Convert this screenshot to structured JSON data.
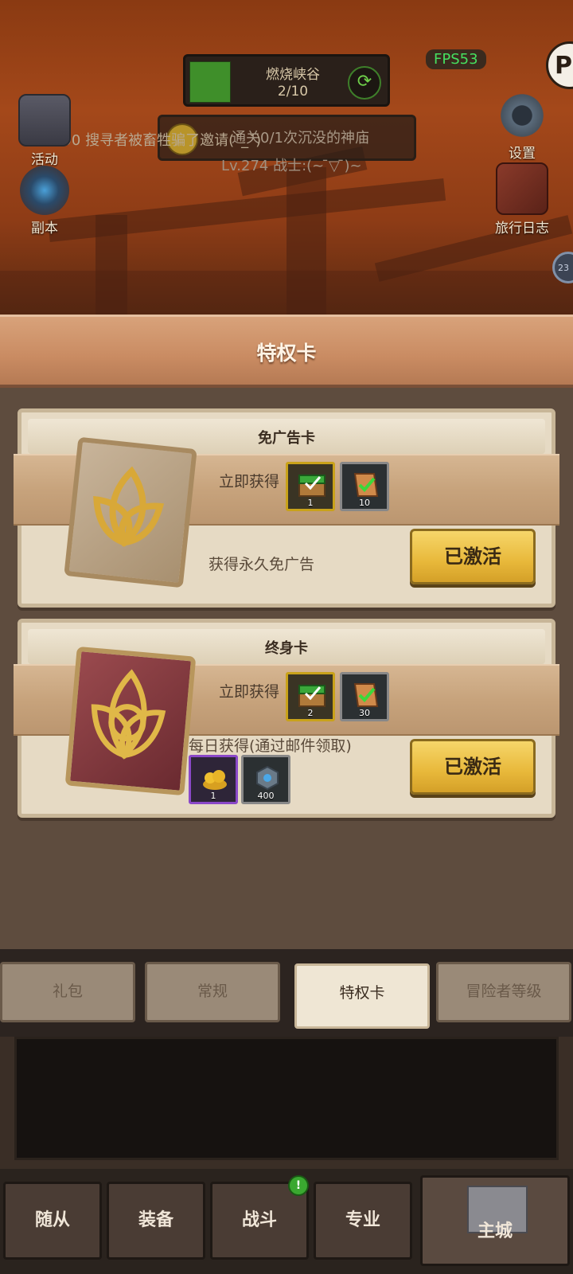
{
  "hud": {
    "zone_name": "燃烧峡谷",
    "zone_progress": "2/10",
    "quest_text": "通关0/1次沉没的神庙",
    "fps": "FPS53",
    "chat_line1": "Lv.290 搜寻者被畜牲骗了邀请(ˇ_ˇ)",
    "chat_line2": "Lv.274 战士:(~ ̄▽ ̄)~",
    "side_left": [
      {
        "label": "活动",
        "icon": "events-icon"
      },
      {
        "label": "副本",
        "icon": "dungeon-icon"
      }
    ],
    "side_right": [
      {
        "label": "设置",
        "icon": "gear-icon"
      },
      {
        "label": "旅行日志",
        "icon": "journal-icon"
      }
    ],
    "chat_bubble_count": "23"
  },
  "panel": {
    "title": "特权卡"
  },
  "cards": [
    {
      "title": "免广告卡",
      "instant_label": "立即获得",
      "instant_items": [
        {
          "icon": "chest-icon",
          "count": "1",
          "frame": "gold"
        },
        {
          "icon": "ticket-icon",
          "count": "10",
          "frame": "gray"
        }
      ],
      "description": "获得永久免广告",
      "button": "已激活"
    },
    {
      "title": "终身卡",
      "instant_label": "立即获得",
      "instant_items": [
        {
          "icon": "chest-icon",
          "count": "2",
          "frame": "gold"
        },
        {
          "icon": "ticket-icon",
          "count": "30",
          "frame": "gray"
        }
      ],
      "daily_label": "每日获得(通过邮件领取)",
      "daily_items": [
        {
          "icon": "gold-pile-icon",
          "count": "1",
          "frame": "purple"
        },
        {
          "icon": "gem-icon",
          "count": "400",
          "frame": "gray"
        }
      ],
      "button": "已激活"
    }
  ],
  "tabs": [
    {
      "label": "礼包",
      "active": false
    },
    {
      "label": "常规",
      "active": false
    },
    {
      "label": "特权卡",
      "active": true
    },
    {
      "label": "冒险者等级",
      "active": false
    }
  ],
  "bottom_nav": [
    {
      "label": "随从"
    },
    {
      "label": "装备"
    },
    {
      "label": "战斗",
      "badge": "!"
    },
    {
      "label": "专业"
    },
    {
      "label": "主城"
    }
  ],
  "colors": {
    "accent_button": "#e8b83a",
    "fps_green": "#46e060",
    "panel_header": "#c98b62"
  }
}
